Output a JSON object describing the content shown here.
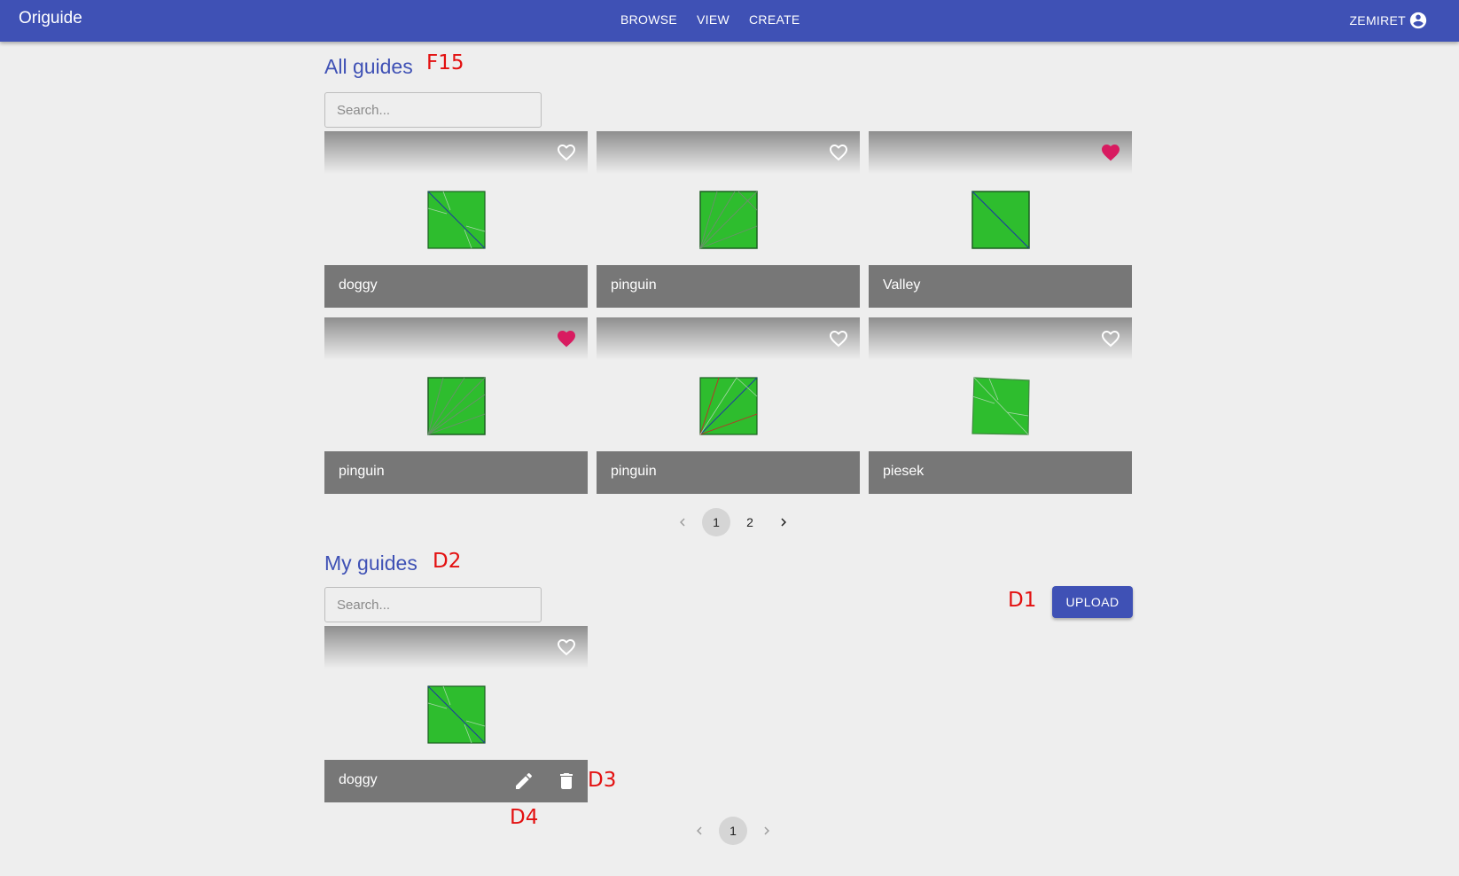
{
  "app": {
    "title": "Origuide",
    "nav": [
      "BROWSE",
      "VIEW",
      "CREATE"
    ],
    "user": "ZEMIRET"
  },
  "all_guides": {
    "title": "All guides",
    "annotation": "F15",
    "search_placeholder": "Search...",
    "cards": [
      {
        "name": "doggy",
        "favorite": false
      },
      {
        "name": "pinguin",
        "favorite": false
      },
      {
        "name": "Valley",
        "favorite": true
      },
      {
        "name": "pinguin",
        "favorite": true
      },
      {
        "name": "pinguin",
        "favorite": false
      },
      {
        "name": "piesek",
        "favorite": false
      }
    ],
    "pages": [
      "1",
      "2"
    ],
    "current_page": "1"
  },
  "my_guides": {
    "title": "My guides",
    "annotation": "D2",
    "search_placeholder": "Search...",
    "upload_label": "UPLOAD",
    "upload_annotation": "D1",
    "cards": [
      {
        "name": "doggy",
        "favorite": false
      }
    ],
    "edit_annotation": "D4",
    "delete_annotation": "D3",
    "pages": [
      "1"
    ],
    "current_page": "1"
  },
  "colors": {
    "primary": "#3f51b5",
    "favorite": "#d81b60",
    "annotation": "#e31010",
    "paper_green": "#2ebd2e"
  },
  "icons": {
    "favorite": "heart-icon",
    "not_favorite": "heart-outline-icon",
    "account": "account-circle-icon",
    "edit": "pencil-icon",
    "delete": "trash-icon",
    "prev": "chevron-left-icon",
    "next": "chevron-right-icon"
  }
}
